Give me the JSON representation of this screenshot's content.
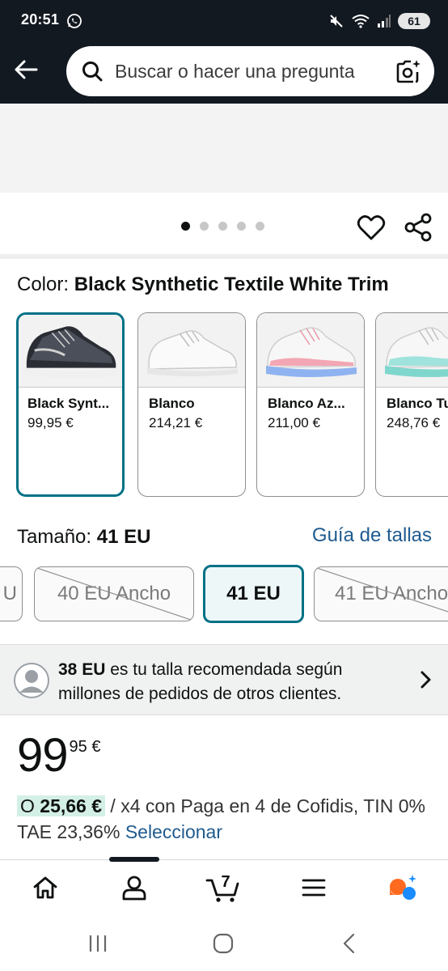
{
  "status_bar": {
    "time": "20:51",
    "battery": "61"
  },
  "header": {
    "search_placeholder": "Buscar o hacer una pregunta"
  },
  "gallery": {
    "dot_count": 5,
    "active_index": 0
  },
  "color": {
    "label": "Color:",
    "selected": "Black Synthetic Textile White Trim",
    "options": [
      {
        "name": "Black Synt...",
        "price": "99,95 €",
        "selected": true
      },
      {
        "name": "Blanco",
        "price": "214,21 €",
        "selected": false
      },
      {
        "name": "Blanco Az...",
        "price": "211,00 €",
        "selected": false
      },
      {
        "name": "Blanco Tu",
        "price": "248,76 €",
        "selected": false
      }
    ]
  },
  "size": {
    "label": "Tamaño:",
    "selected": "41 EU",
    "guide_link": "Guía de tallas",
    "options": [
      {
        "label": "U",
        "available": false
      },
      {
        "label": "40 EU Ancho",
        "available": false
      },
      {
        "label": "41 EU",
        "available": true,
        "selected": true
      },
      {
        "label": "41 EU Ancho",
        "available": false
      }
    ]
  },
  "recommendation": {
    "size": "38 EU",
    "text": "es tu talla recomendada según millones de pedidos de otros clientes."
  },
  "price": {
    "whole": "99",
    "fraction": "95 €"
  },
  "financing": {
    "prefix": "O",
    "amount": "25,66 €",
    "text": "/ x4 con Paga en 4 de Cofidis, TIN 0% TAE 23,36%",
    "link": "Seleccionar"
  },
  "bottom_nav": {
    "active": "account",
    "cart_count": "7"
  },
  "colors": {
    "header_bg": "#131921",
    "accent": "#007185",
    "link": "#1f5b8f",
    "highlight": "#d4f0e6"
  }
}
